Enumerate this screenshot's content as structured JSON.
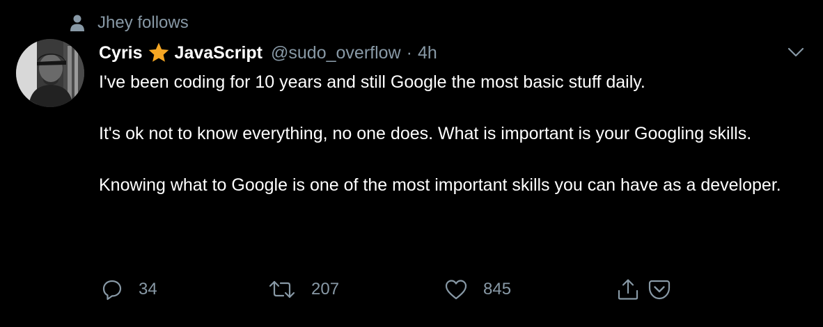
{
  "social_context": {
    "icon": "person-icon",
    "text": "Jhey follows"
  },
  "author": {
    "display_name": "Cyris",
    "badge_icon": "star-icon",
    "bio_tag": "JavaScript",
    "handle": "@sudo_overflow",
    "separator": "·",
    "time": "4h"
  },
  "menu_icon": "chevron-down-icon",
  "tweet": {
    "paragraphs": [
      "I've been coding for 10 years and still Google the most basic stuff daily.",
      "It's ok not to know everything, no one does. What is important is your Googling skills.",
      "Knowing what to Google is one of the most important skills you can have as a developer."
    ]
  },
  "actions": {
    "reply_count": "34",
    "retweet_count": "207",
    "like_count": "845",
    "share_icon": "share-icon",
    "save_icon": "pocket-save-icon"
  },
  "colors": {
    "background": "#000000",
    "text": "#ffffff",
    "muted": "#8899a6",
    "star": "#f5a623"
  }
}
